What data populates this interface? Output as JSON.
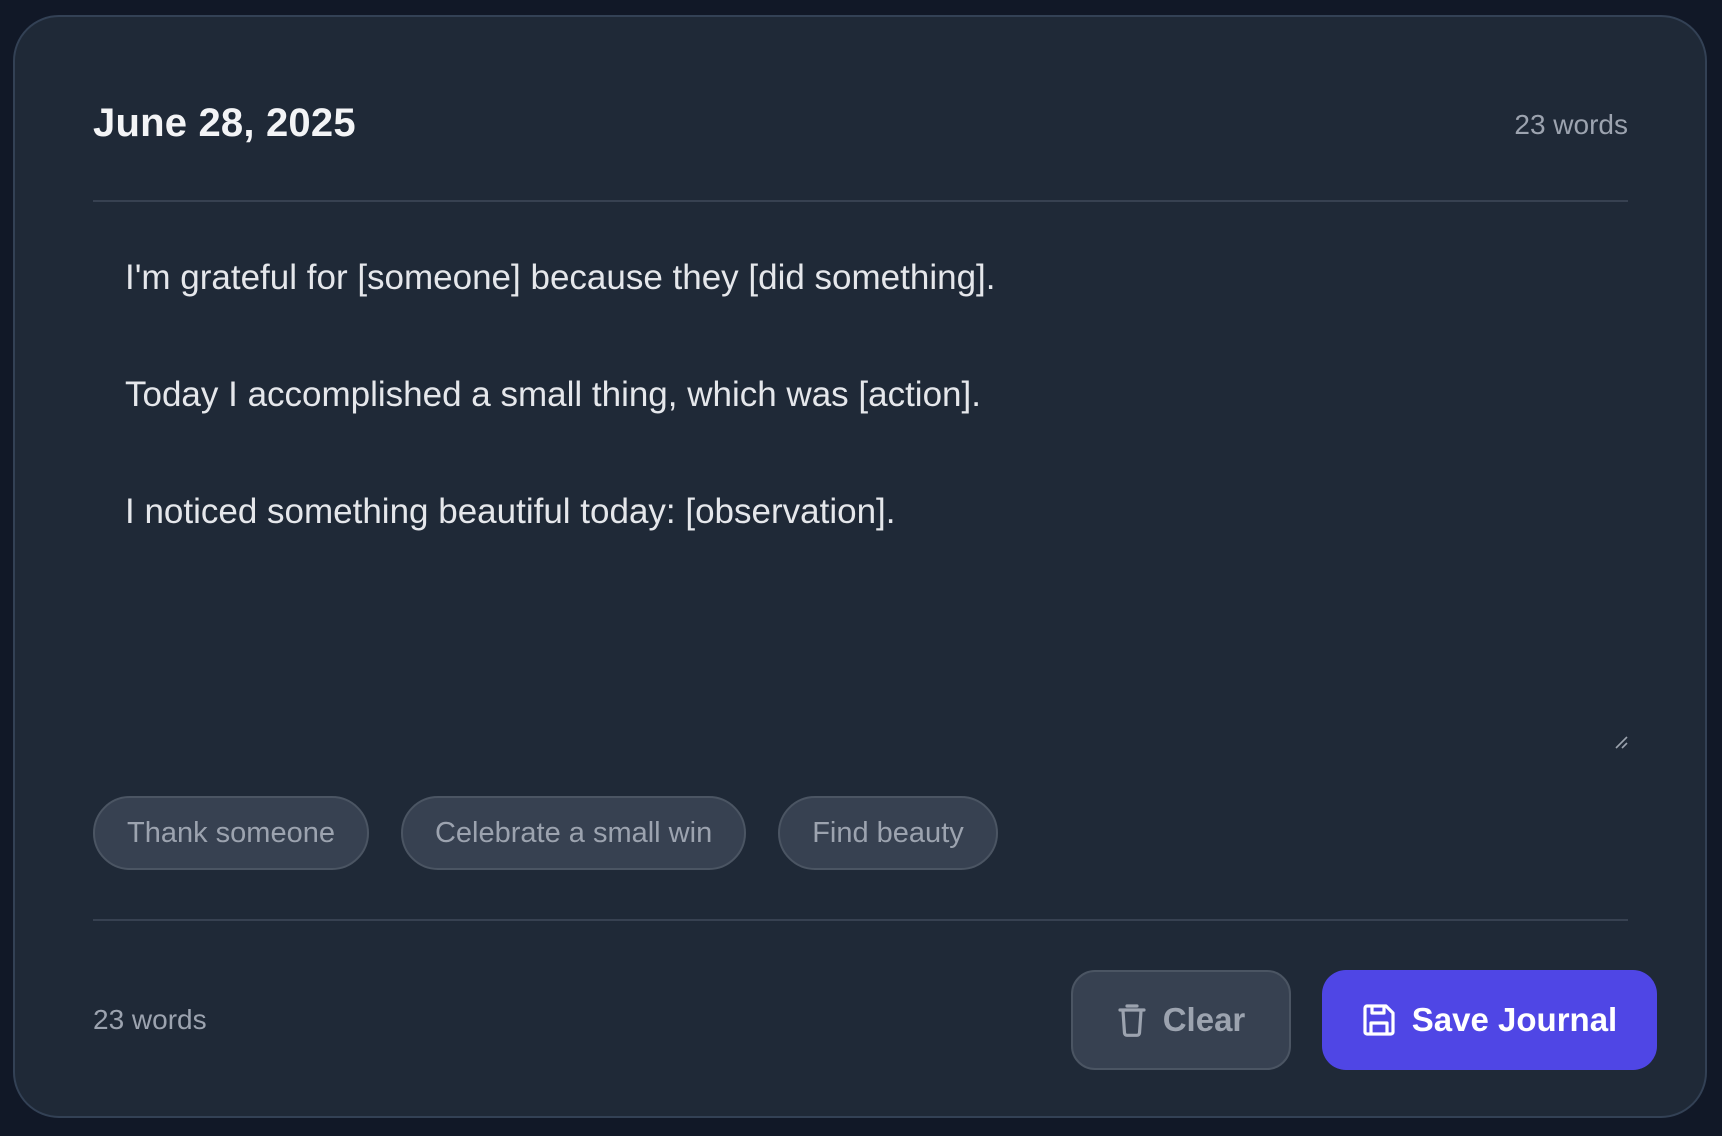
{
  "journal": {
    "date": "June 28, 2025",
    "word_count_top": "23 words",
    "entry_lines": [
      "I'm grateful for [someone] because they [did something].",
      "Today I accomplished a small thing, which was [action].",
      "I noticed something beautiful today: [observation]."
    ],
    "prompts": [
      "Thank someone",
      "Celebrate a small win",
      "Find beauty"
    ],
    "word_count_bottom": "23 words"
  },
  "actions": {
    "clear_label": "Clear",
    "clear_icon": "trash-icon",
    "save_label": "Save Journal",
    "save_icon": "floppy-disk-icon"
  },
  "colors": {
    "background": "#111827",
    "card": "#1f2937",
    "accent": "#4f46e5"
  }
}
